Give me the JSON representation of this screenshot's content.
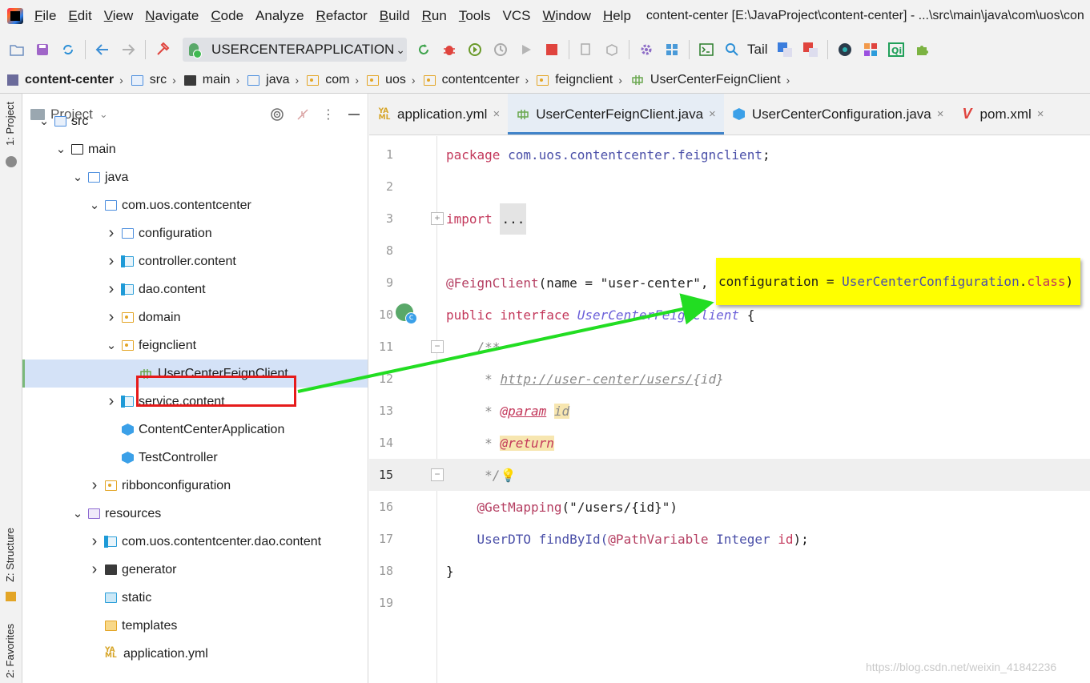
{
  "menubar": {
    "items": [
      {
        "mnemonic": "F",
        "rest": "ile"
      },
      {
        "mnemonic": "E",
        "rest": "dit"
      },
      {
        "mnemonic": "V",
        "rest": "iew"
      },
      {
        "mnemonic": "N",
        "rest": "avigate"
      },
      {
        "mnemonic": "C",
        "rest": "ode"
      },
      {
        "mnemonic": "",
        "rest": "Analyze"
      },
      {
        "mnemonic": "R",
        "rest": "efactor"
      },
      {
        "mnemonic": "B",
        "rest": "uild"
      },
      {
        "mnemonic": "R",
        "rest": "un"
      },
      {
        "mnemonic": "T",
        "rest": "ools"
      },
      {
        "mnemonic": "",
        "rest": "VCS"
      },
      {
        "mnemonic": "W",
        "rest": "indow"
      },
      {
        "mnemonic": "H",
        "rest": "elp"
      }
    ],
    "window_title": "content-center [E:\\JavaProject\\content-center] - ...\\src\\main\\java\\com\\uos\\con"
  },
  "toolbar": {
    "run_config": "USERCENTERAPPLICATION",
    "tail_label": "Tail"
  },
  "breadcrumb": [
    "content-center",
    "src",
    "main",
    "java",
    "com",
    "uos",
    "contentcenter",
    "feignclient",
    "UserCenterFeignClient"
  ],
  "side_tabs": {
    "project": "1: Project",
    "structure": "Z: Structure",
    "favorites": "2: Favorites"
  },
  "project_panel": {
    "title": "Project",
    "tree": [
      {
        "label": "src",
        "depth": 1,
        "arrow": "open",
        "icon": "srcfolder"
      },
      {
        "label": "main",
        "depth": 2,
        "arrow": "open",
        "icon": "black"
      },
      {
        "label": "java",
        "depth": 3,
        "arrow": "open",
        "icon": "dir"
      },
      {
        "label": "com.uos.contentcenter",
        "depth": 4,
        "arrow": "open",
        "icon": "dir"
      },
      {
        "label": "configuration",
        "depth": 5,
        "arrow": "closed",
        "icon": "dir"
      },
      {
        "label": "controller.content",
        "depth": 5,
        "arrow": "closed",
        "icon": "tealpkg"
      },
      {
        "label": "dao.content",
        "depth": 5,
        "arrow": "closed",
        "icon": "tealpkg"
      },
      {
        "label": "domain",
        "depth": 5,
        "arrow": "closed",
        "icon": "pkg"
      },
      {
        "label": "feignclient",
        "depth": 5,
        "arrow": "open",
        "icon": "pkg"
      },
      {
        "label": "UserCenterFeignClient",
        "depth": 6,
        "arrow": "none",
        "icon": "feign",
        "selected": true
      },
      {
        "label": "service.content",
        "depth": 5,
        "arrow": "closed",
        "icon": "tealpkg"
      },
      {
        "label": "ContentCenterApplication",
        "depth": 5,
        "arrow": "none",
        "icon": "app"
      },
      {
        "label": "TestController",
        "depth": 5,
        "arrow": "none",
        "icon": "cls"
      },
      {
        "label": "ribbonconfiguration",
        "depth": 4,
        "arrow": "closed",
        "icon": "pkg"
      },
      {
        "label": "resources",
        "depth": 3,
        "arrow": "open",
        "icon": "res"
      },
      {
        "label": "com.uos.contentcenter.dao.content",
        "depth": 4,
        "arrow": "closed",
        "icon": "tealpkg"
      },
      {
        "label": "generator",
        "depth": 4,
        "arrow": "closed",
        "icon": "blackfill"
      },
      {
        "label": "static",
        "depth": 4,
        "arrow": "none",
        "icon": "bluefill"
      },
      {
        "label": "templates",
        "depth": 4,
        "arrow": "none",
        "icon": "yellowfill"
      },
      {
        "label": "application.yml",
        "depth": 4,
        "arrow": "none",
        "icon": "yml"
      }
    ]
  },
  "tabs": [
    {
      "label": "application.yml",
      "icon": "yml",
      "active": false
    },
    {
      "label": "UserCenterFeignClient.java",
      "icon": "feign",
      "active": true
    },
    {
      "label": "UserCenterConfiguration.java",
      "icon": "cls",
      "active": false
    },
    {
      "label": "pom.xml",
      "icon": "maven",
      "active": false
    }
  ],
  "editor": {
    "line_numbers": [
      "1",
      "2",
      "3",
      "8",
      "9",
      "10",
      "11",
      "12",
      "13",
      "14",
      "15",
      "16",
      "17",
      "18",
      "19"
    ],
    "current_line": "15",
    "code": {
      "l1_kw": "package",
      "l1_pkg": " com.uos.contentcenter.feignclient",
      "l1_end": ";",
      "l3_kw": "import",
      "l3_fold": "...",
      "l9_ann": "@FeignClient",
      "l9_rest": "(name = \"user-center\",",
      "l10_kw": "public interface",
      "l10_name": "UserCenterFeignClient",
      "l10_end": " {",
      "l11": "/**",
      "l12_star": "* ",
      "l12_link": "http://user-center/users/",
      "l12_id": "{id}",
      "l13_star": "* ",
      "l13_tag": "@param",
      "l13_id": "id",
      "l14_star": "* ",
      "l14_tag": "@return",
      "l15": "*/",
      "l15_bulb": "💡",
      "l16_ann": "@GetMapping",
      "l16_rest": "(\"/users/{id}\")",
      "l17_type": "UserDTO",
      "l17_method": " findById(",
      "l17_ann": "@PathVariable",
      "l17_type2": " Integer ",
      "l17_param": "id",
      "l17_end": ");",
      "l18": "}"
    }
  },
  "callout": {
    "name": "configuration",
    "eq": " = ",
    "cls": "UserCenterConfiguration",
    "dot": ".",
    "kw": "class",
    "close": ")"
  },
  "watermark": "https://blog.csdn.net/weixin_41842236",
  "colors": {
    "arrow": "#22dd22",
    "highlight_box": "#e61b1b",
    "callout_bg": "#ffff00"
  }
}
